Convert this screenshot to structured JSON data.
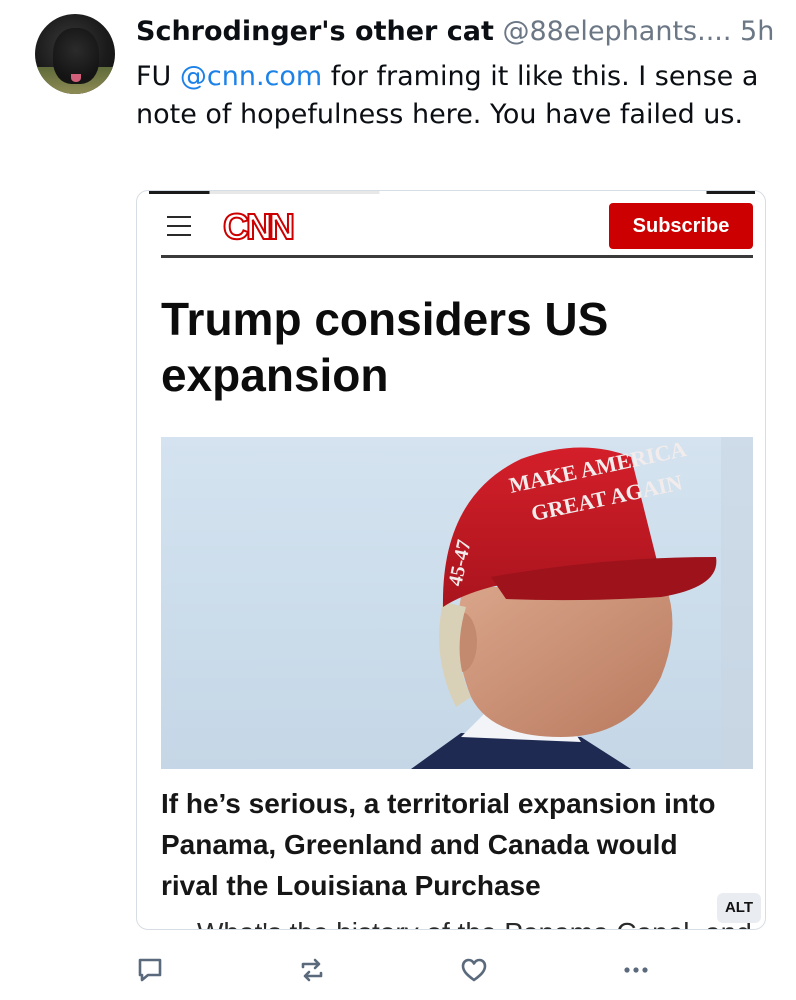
{
  "post": {
    "author_name": "Schrodinger's other cat",
    "handle": "@88elephants....",
    "timestamp": "5h",
    "text_before": "FU ",
    "mention": "@cnn.com",
    "text_after": " for framing it like this. I sense a note of hopefulness here. You have failed us."
  },
  "embed": {
    "logo": "CNN",
    "subscribe_label": "Subscribe",
    "headline": "Trump considers US expansion",
    "subhead": "If he’s serious, a territorial expansion into Panama, Greenland and Canada would rival the Louisiana Purchase",
    "cutoff_text": "What's the history of the Panama Canal, and",
    "alt_label": "ALT",
    "hat_text": {
      "line1": "MAKE AMERICA",
      "line2": "GREAT AGAIN",
      "side": "45-47"
    }
  },
  "actions": {
    "reply_icon": "reply-icon",
    "repost_icon": "repost-icon",
    "like_icon": "like-icon",
    "more_icon": "more-icon"
  },
  "colors": {
    "mention": "#1d82e8",
    "cnn_red": "#cc0000",
    "muted": "#6b7785",
    "icon": "#5a6a7c"
  }
}
